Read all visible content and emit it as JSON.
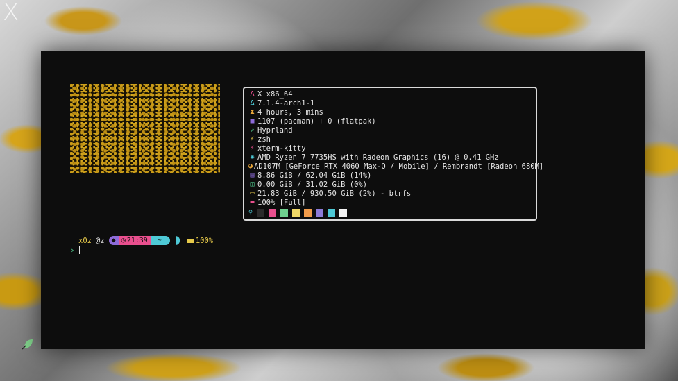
{
  "desktop": {
    "corner_label": "X"
  },
  "terminal": {
    "sysinfo": [
      {
        "icon": "arch-icon",
        "glyph": "Λ",
        "color": "#e94f8e",
        "text": "X x86_64"
      },
      {
        "icon": "kernel-icon",
        "glyph": "Δ",
        "color": "#4ec9d6",
        "text": "7.1.4-arch1-1"
      },
      {
        "icon": "hourglass-icon",
        "glyph": "⧗",
        "color": "#e6a53a",
        "text": "4 hours, 3 mins"
      },
      {
        "icon": "package-icon",
        "glyph": "■",
        "color": "#8d6bd8",
        "text": "1107 (pacman) + 0 (flatpak)"
      },
      {
        "icon": "window-manager-icon",
        "glyph": "↗",
        "color": "#4ec48a",
        "text": "Hyprland"
      },
      {
        "icon": "shell-icon",
        "glyph": "⚡",
        "color": "#e6c94a",
        "text": "zsh"
      },
      {
        "icon": "terminal-icon",
        "glyph": "⚡",
        "color": "#e94f8e",
        "text": "xterm-kitty"
      },
      {
        "icon": "cpu-icon",
        "glyph": "✺",
        "color": "#4ec9d6",
        "text": "AMD Ryzen 7 7735HS with Radeon Graphics (16) @ 0.41 GHz"
      },
      {
        "icon": "gpu-icon",
        "glyph": "◕",
        "color": "#e6a53a",
        "text": "AD107M [GeForce RTX 4060 Max-Q / Mobile] / Rembrandt [Radeon 680M]"
      },
      {
        "icon": "memory-icon",
        "glyph": "▤",
        "color": "#8d6bd8",
        "text": "8.86 GiB / 62.04 GiB (14%)"
      },
      {
        "icon": "swap-icon",
        "glyph": "◫",
        "color": "#4ec48a",
        "text": "0.00 GiB / 31.02 GiB (0%)"
      },
      {
        "icon": "disk-icon",
        "glyph": "▭",
        "color": "#e6c94a",
        "text": "21.83 GiB / 930.50 GiB (2%) - btrfs"
      },
      {
        "icon": "battery-icon",
        "glyph": "▬",
        "color": "#e94f8e",
        "text": "100% [Full]"
      }
    ],
    "palette_icon": "bulb-icon",
    "palette": [
      "#2b2b2b",
      "#e94f8e",
      "#6fd18f",
      "#f0d867",
      "#f29b4a",
      "#8d7bd8",
      "#4ec9d6",
      "#f4f4f4"
    ],
    "prompt": {
      "user": "x0z",
      "host": "@z",
      "time": "21:39",
      "dir": "~",
      "battery": "100%",
      "chevron": "›"
    }
  }
}
